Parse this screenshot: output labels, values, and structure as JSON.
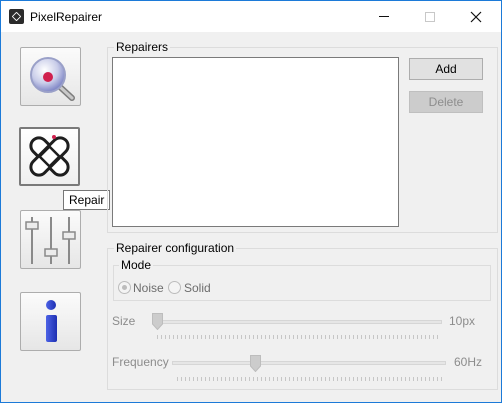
{
  "window": {
    "title": "PixelRepairer",
    "minimize_icon": "minimize-icon",
    "maximize_icon": "maximize-icon",
    "close_icon": "close-icon"
  },
  "sidebar": {
    "items": [
      {
        "name": "locate",
        "icon": "magnifier-icon"
      },
      {
        "name": "repair",
        "icon": "bandage-icon",
        "active": true
      },
      {
        "name": "settings",
        "icon": "sliders-icon"
      },
      {
        "name": "info",
        "icon": "info-icon"
      }
    ],
    "tooltip": "Repair"
  },
  "repairers": {
    "label": "Repairers",
    "items": [],
    "add_label": "Add",
    "delete_label": "Delete"
  },
  "config": {
    "label": "Repairer configuration",
    "mode": {
      "label": "Mode",
      "options": [
        "Noise",
        "Solid"
      ],
      "selected": "Noise"
    },
    "size": {
      "label": "Size",
      "value_label": "10px",
      "position": 0
    },
    "frequency": {
      "label": "Frequency",
      "value_label": "60Hz",
      "position": 0.3
    }
  },
  "colors": {
    "accent_border": "#1c7ad8",
    "window_bg": "#f0f0f0",
    "disabled_text": "#8c8c8c"
  }
}
